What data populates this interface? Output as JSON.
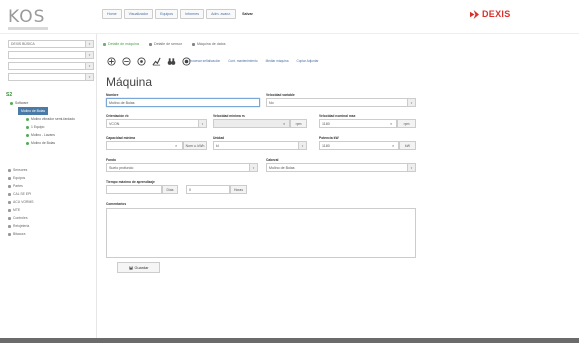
{
  "header": {
    "logo": "KOS",
    "nav": [
      {
        "label": "Home"
      },
      {
        "label": "Visualizador"
      },
      {
        "label": "Equipos"
      },
      {
        "label": "Informes"
      },
      {
        "label": "Adm. avanz."
      },
      {
        "label": "Salvar"
      }
    ],
    "brand": "DEXIS",
    "brand_color": "#d9302b"
  },
  "sidebar": {
    "selects": [
      {
        "value": "DEXIS BÚSICA"
      },
      {
        "value": ""
      },
      {
        "value": ""
      },
      {
        "value": ""
      }
    ],
    "tree": [
      {
        "label": "S2",
        "level": 0,
        "kind": "root"
      },
      {
        "label": "Software",
        "level": 1
      },
      {
        "label": "Molino de Bolas",
        "level": 2,
        "kind": "active"
      },
      {
        "label": "Molino vibrador semi-fardado",
        "level": 3
      },
      {
        "label": "1 Equipo",
        "level": 3
      },
      {
        "label": "Molino - Lavans",
        "level": 3
      },
      {
        "label": "Molino de Bolas",
        "level": 3
      }
    ],
    "menu": [
      "Sensores",
      "Equipos",
      "Partes",
      "CAL SE EPI",
      "ACU VORMS",
      "MTE",
      "Controles",
      "Relojeteria",
      "Bitacora"
    ]
  },
  "main": {
    "tabs": [
      {
        "label": "Detalle de máquina"
      },
      {
        "label": "Detalle de sensor"
      },
      {
        "label": "Máquina de datos"
      }
    ],
    "icon_links": [
      "Procesar señalización",
      "Cont. mantenimiento",
      "Mediar máquina",
      "Copiar Adjuntar"
    ],
    "title": "Máquina",
    "form": {
      "nombre_label": "Nombre",
      "nombre_value": "Molino de Bolas",
      "velocidad_variable_label": "Velocidad variable",
      "velocidad_variable_value": "No",
      "orientacion_label": "Orientación rb",
      "orientacion_value": "VCON",
      "vel_minima_label": "Velocidad mínima rs",
      "vel_minima_unit": "rpm",
      "vel_nominal_label": "Velocidad nominal max",
      "vel_nominal_value": "1180",
      "vel_nominal_unit": "rpm",
      "capacidad_label": "Capacidad mínima",
      "capacidad_unit": "Nom u. kWh",
      "unidad_label": "Unidad",
      "unidad_value": "kI",
      "potencia_label": "Potencia kW",
      "potencia_value": "1180",
      "potencia_unit": "kW",
      "fondo_label": "Fondo",
      "fondo_value": "Suelo profundo",
      "cabezal_label": "Cabezal",
      "cabezal_value": "Molino de Bolas",
      "tiempo_label": "Tiempo máximo de aprendizaje",
      "tiempo_unit1": "Días",
      "tiempo_value": "0",
      "tiempo_unit2": "Horas",
      "comentarios_label": "Comentarios",
      "save_label": "Guardar"
    }
  }
}
